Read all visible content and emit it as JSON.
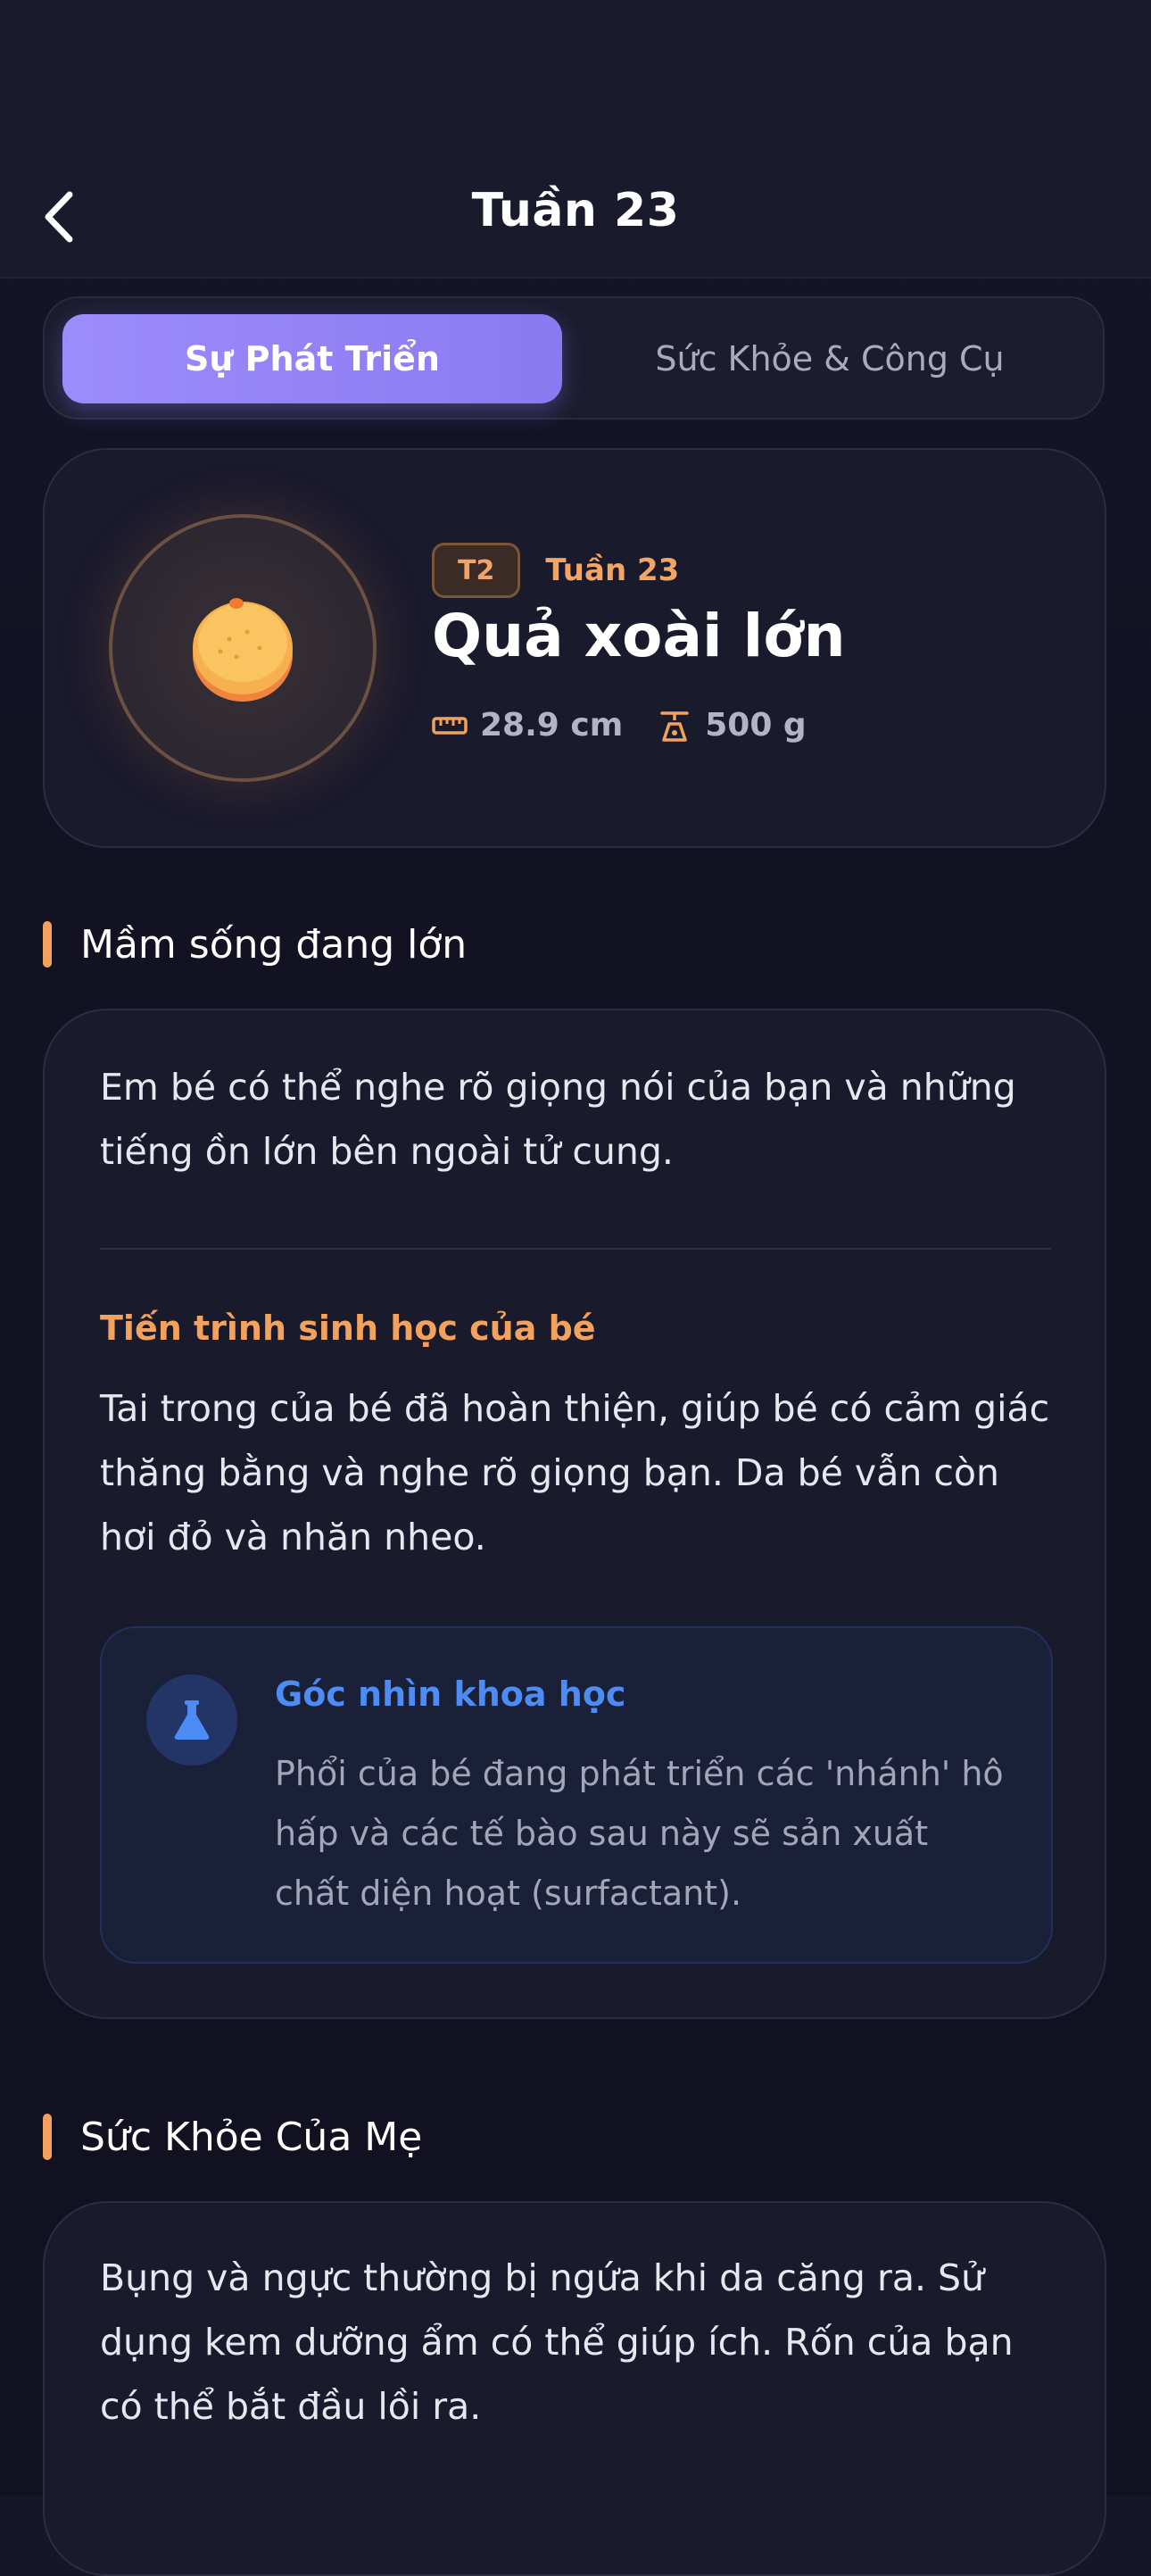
{
  "header": {
    "title": "Tuần 23"
  },
  "tabs": [
    {
      "label": "Sự Phát Triển",
      "active": true
    },
    {
      "label": "Sức Khỏe & Công Cụ",
      "active": false
    }
  ],
  "hero": {
    "trimester": "T2",
    "week": "Tuần 23",
    "fruit": "Quả xoài lớn",
    "length": "28.9 cm",
    "weight": "500 g",
    "fruit_icon": "mango-icon"
  },
  "sections": {
    "growth_title": "Mầm sống đang lớn",
    "growth_intro": "Em bé có thể nghe rõ giọng nói của bạn và những tiếng ồn lớn bên ngoài tử cung.",
    "bio_title": "Tiến trình sinh học của bé",
    "bio_text": "Tai trong của bé đã hoàn thiện, giúp bé có cảm giác thăng bằng và nghe rõ giọng bạn. Da bé vẫn còn hơi đỏ và nhăn nheo.",
    "science_title": "Góc nhìn khoa học",
    "science_text": "Phổi của bé đang phát triển các 'nhánh' hô hấp và các tế bào sau này sẽ sản xuất chất diện hoạt (surfactant).",
    "mom_title": "Sức Khỏe Của Mẹ",
    "mom_text": "Bụng và ngực thường bị ngứa khi da căng ra. Sử dụng kem dưỡng ẩm có thể giúp ích. Rốn của bạn có thể bắt đầu lồi ra."
  },
  "colors": {
    "accent_orange": "#f3a25e",
    "accent_purple": "#9d8cfb",
    "science_blue": "#4d8cf5"
  }
}
